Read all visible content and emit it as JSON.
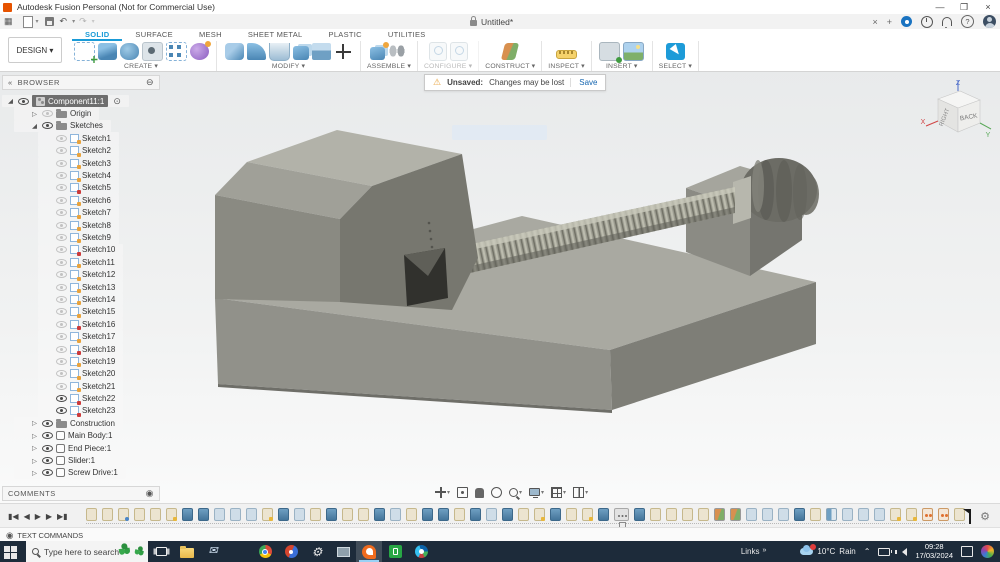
{
  "window": {
    "title": "Autodesk Fusion Personal (Not for Commercial Use)"
  },
  "icons": {
    "minimize": "—",
    "maximize": "❐",
    "close": "×",
    "tab_close": "×",
    "new_tab": "+",
    "app_grid": "▦",
    "undo": "↶",
    "redo": "↷",
    "caret": "▾",
    "help": "?",
    "double_left": "«",
    "minus_circle": "⊖",
    "dot_circle": "◉",
    "radio": "⊙",
    "warning": "⚠",
    "gear": "⚙",
    "expand_collapsed": "▷",
    "expand_expanded": "◢",
    "links_chevrons": "»",
    "tray_chevron": "⌃",
    "mail_glyph": "✉"
  },
  "doc_tab": {
    "label": "Untitled*"
  },
  "ribbon": {
    "design_menu": "DESIGN ▾",
    "tabs": [
      {
        "label": "SOLID",
        "active": true
      },
      {
        "label": "SURFACE",
        "active": false
      },
      {
        "label": "MESH",
        "active": false
      },
      {
        "label": "SHEET METAL",
        "active": false
      },
      {
        "label": "PLASTIC",
        "active": false
      },
      {
        "label": "UTILITIES",
        "active": false
      }
    ],
    "groups": [
      {
        "label": "CREATE",
        "icons": [
          "sketch-create",
          "extrude",
          "revolve",
          "hole",
          "pattern",
          "form"
        ]
      },
      {
        "label": "MODIFY",
        "icons": [
          "press-pull",
          "fillet",
          "shell",
          "combine",
          "offset",
          "move"
        ]
      },
      {
        "label": "ASSEMBLE",
        "icons": [
          "new-component",
          "joint"
        ]
      },
      {
        "label": "CONFIGURE",
        "icons": [
          "config-table",
          "config-table"
        ],
        "disabled": true
      },
      {
        "label": "CONSTRUCT",
        "icons": [
          "plane"
        ]
      },
      {
        "label": "INSPECT",
        "icons": [
          "measure"
        ]
      },
      {
        "label": "INSERT",
        "icons": [
          "insert-mesh",
          "insert-image"
        ]
      },
      {
        "label": "SELECT",
        "icons": [
          "select"
        ]
      }
    ]
  },
  "notification": {
    "title": "Unsaved:",
    "message": "Changes may be lost",
    "action": "Save"
  },
  "browser": {
    "header": "BROWSER",
    "component": {
      "name": "Component11:1"
    },
    "origin_label": "Origin",
    "sketches_label": "Sketches",
    "sketches": [
      {
        "name": "Sketch1",
        "locked": false,
        "visible": false
      },
      {
        "name": "Sketch2",
        "locked": false,
        "visible": false
      },
      {
        "name": "Sketch3",
        "locked": false,
        "visible": false
      },
      {
        "name": "Sketch4",
        "locked": false,
        "visible": false
      },
      {
        "name": "Sketch5",
        "locked": true,
        "visible": false
      },
      {
        "name": "Sketch6",
        "locked": false,
        "visible": false
      },
      {
        "name": "Sketch7",
        "locked": false,
        "visible": false
      },
      {
        "name": "Sketch8",
        "locked": false,
        "visible": false
      },
      {
        "name": "Sketch9",
        "locked": false,
        "visible": false
      },
      {
        "name": "Sketch10",
        "locked": true,
        "visible": false
      },
      {
        "name": "Sketch11",
        "locked": false,
        "visible": false
      },
      {
        "name": "Sketch12",
        "locked": false,
        "visible": false
      },
      {
        "name": "Sketch13",
        "locked": false,
        "visible": false
      },
      {
        "name": "Sketch14",
        "locked": false,
        "visible": false
      },
      {
        "name": "Sketch15",
        "locked": false,
        "visible": false
      },
      {
        "name": "Sketch16",
        "locked": true,
        "visible": false
      },
      {
        "name": "Sketch17",
        "locked": false,
        "visible": false
      },
      {
        "name": "Sketch18",
        "locked": true,
        "visible": false
      },
      {
        "name": "Sketch19",
        "locked": false,
        "visible": false
      },
      {
        "name": "Sketch20",
        "locked": false,
        "visible": false
      },
      {
        "name": "Sketch21",
        "locked": false,
        "visible": false
      },
      {
        "name": "Sketch22",
        "locked": true,
        "visible": true
      },
      {
        "name": "Sketch23",
        "locked": true,
        "visible": true
      }
    ],
    "items": [
      {
        "name": "Construction",
        "icon": "folder"
      },
      {
        "name": "Main Body:1",
        "icon": "body"
      },
      {
        "name": "End Piece:1",
        "icon": "body"
      },
      {
        "name": "Slider:1",
        "icon": "body"
      },
      {
        "name": "Screw Drive:1",
        "icon": "body"
      }
    ]
  },
  "viewcube": {
    "face": "BACK",
    "side_face": "RIGHT",
    "axes": {
      "x": "X",
      "y": "Y",
      "z": "Z"
    },
    "axis_colors": {
      "x": "#d04545",
      "y": "#58a858",
      "z": "#4868c8"
    }
  },
  "comments": {
    "label": "COMMENTS"
  },
  "text_commands": {
    "label": "TEXT COMMANDS"
  },
  "navbar": {
    "items": [
      {
        "name": "pan-orbit",
        "caret": true
      },
      {
        "name": "look-at",
        "caret": false
      },
      {
        "name": "pan-hand",
        "caret": false
      },
      {
        "name": "orbit",
        "caret": false
      },
      {
        "name": "zoom",
        "caret": true
      },
      {
        "name": "display",
        "caret": true
      },
      {
        "name": "grid-snaps",
        "caret": true
      },
      {
        "name": "viewports",
        "caret": true
      }
    ]
  },
  "timeline": {
    "playback": [
      {
        "name": "go-to-start",
        "glyph": "▮◀"
      },
      {
        "name": "step-back",
        "glyph": "◀"
      },
      {
        "name": "play",
        "glyph": "▶"
      },
      {
        "name": "step-forward",
        "glyph": "▶"
      },
      {
        "name": "go-to-end",
        "glyph": "▶▮"
      }
    ],
    "markers": [
      "sketch",
      "sketch",
      "sketch-pin",
      "sketch",
      "sketch",
      "sketch-edit",
      "extrude",
      "extrude",
      "body",
      "body",
      "body",
      "sketch-edit",
      "extrude",
      "body",
      "sketch",
      "extrude",
      "sketch",
      "sketch",
      "extrude",
      "body",
      "sketch",
      "extrude",
      "extrude",
      "sketch",
      "extrude",
      "body",
      "extrude",
      "sketch",
      "sketch-edit",
      "extrude",
      "sketch",
      "sketch-edit",
      "extrude",
      "ellipsis",
      "extrude",
      "sketch",
      "sketch",
      "sketch",
      "sketch",
      "plane",
      "plane",
      "body",
      "body",
      "body",
      "extrude",
      "sketch",
      "mirror",
      "body",
      "body",
      "body",
      "sketch-edit",
      "sketch-edit",
      "joint",
      "joint",
      "sketch"
    ]
  },
  "taskbar": {
    "search_placeholder": "Type here to search",
    "apps": [
      {
        "name": "task-view",
        "active": false
      },
      {
        "name": "file-explorer",
        "active": false
      },
      {
        "name": "mail",
        "active": false,
        "glyph": "✉"
      },
      {
        "name": "presentation-app",
        "active": false
      },
      {
        "name": "chrome",
        "active": false
      },
      {
        "name": "paint-3d",
        "active": false
      },
      {
        "name": "settings",
        "active": false,
        "glyph": "⚙"
      },
      {
        "name": "system-app",
        "active": false
      },
      {
        "name": "fusion-360",
        "active": true
      },
      {
        "name": "green-app",
        "active": false
      },
      {
        "name": "edge-browser",
        "active": false
      }
    ],
    "links_label": "Links",
    "weather": {
      "temp": "10°C",
      "condition": "Rain"
    },
    "clock": {
      "time": "09:28",
      "date": "17/03/2024"
    }
  }
}
